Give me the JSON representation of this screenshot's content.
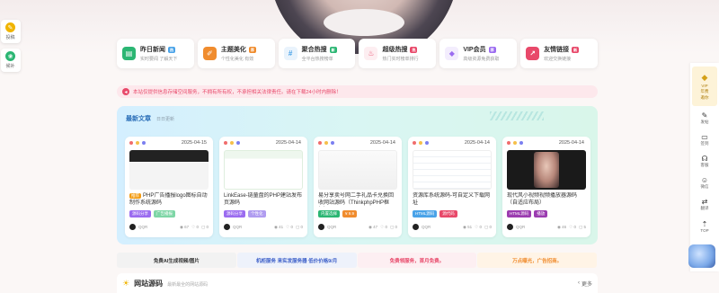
{
  "left_float": [
    {
      "icon": "lightbulb-icon",
      "label": "投稿",
      "color": "#f0b400"
    },
    {
      "icon": "leaf-icon",
      "label": "候补",
      "color": "#2bb673"
    }
  ],
  "nav": [
    {
      "title": "昨日新闻",
      "desc": "实时要闻 了解天下",
      "badge": "热",
      "icon_color": "#2bb673",
      "badge_color": "#4aa3e8",
      "icon": "news-icon"
    },
    {
      "title": "主题美化",
      "desc": "个性化美化 有效",
      "badge": "荐",
      "icon_color": "#f08c2e",
      "badge_color": "#f08c2e",
      "icon": "brush-icon"
    },
    {
      "title": "聚合热搜",
      "desc": "全平台热搜榜单",
      "badge": "新",
      "icon_color": "#4aa3e8",
      "badge_color": "#2bb673",
      "icon": "hash-icon"
    },
    {
      "title": "超级热搜",
      "desc": "热门实时榜单排行",
      "badge": "热",
      "icon_color": "#e8496a",
      "badge_color": "#e8496a",
      "icon": "fire-icon"
    },
    {
      "title": "VIP会员",
      "desc": "高级资源免费获取",
      "badge": "荐",
      "icon_color": "#9b6cf0",
      "badge_color": "#9b6cf0",
      "icon": "vip-diamond-icon"
    },
    {
      "title": "友情链接",
      "desc": "欢迎交换链接",
      "badge": "新",
      "icon_color": "#e8496a",
      "badge_color": "#e8496a",
      "icon": "link-icon"
    }
  ],
  "notice": "本站仅提供信息存储空间服务，不拥有所有权，不承担相关法律责任。请在下载24小时内删除！",
  "latest": {
    "title": "最新文章",
    "subtitle": "日日更新",
    "cards": [
      {
        "date": "2025-04-15",
        "title_tag": "推荐",
        "title": "PHP广告播报logo图标自动制作系统源码",
        "tags": [
          {
            "t": "源码分享",
            "c": "#9b6cf0"
          },
          {
            "t": "广告播报",
            "c": "#7ed6a6"
          }
        ],
        "author": "QQR",
        "views": "67",
        "likes": "0",
        "comments": "0",
        "thumb": "dark"
      },
      {
        "date": "2025-04-14",
        "title_tag": "",
        "title": "LinkEase-链童盘的PHP建站发布页源码",
        "tags": [
          {
            "t": "源码分享",
            "c": "#9b6cf0"
          },
          {
            "t": "个性化",
            "c": "#b09cf0"
          }
        ],
        "author": "QQR",
        "views": "41",
        "likes": "0",
        "comments": "0",
        "thumb": "green"
      },
      {
        "date": "2025-04-14",
        "title_tag": "",
        "title": "易分享卖号网二手礼品卡兑换回收网站源码（ThinkphpPHP框架）",
        "tags": [
          {
            "t": "内置选择",
            "c": "#2bb673"
          },
          {
            "t": "¥ 9.9",
            "c": "#f08c2e"
          }
        ],
        "author": "QQR",
        "views": "47",
        "likes": "0",
        "comments": "0",
        "thumb": "white"
      },
      {
        "date": "2025-04-14",
        "title_tag": "",
        "title": "资源库系统源码-可自定义下载网址",
        "tags": [
          {
            "t": "HTML源码",
            "c": "#4aa3e8"
          },
          {
            "t": "源代码",
            "c": "#e8496a"
          }
        ],
        "author": "QQR",
        "views": "51",
        "likes": "0",
        "comments": "0",
        "thumb": "list"
      },
      {
        "date": "2025-04-14",
        "title_tag": "",
        "title": "现代风小视频视频播放器源码（自适应布局）",
        "tags": [
          {
            "t": "HTML源码",
            "c": "#9b3cb0"
          },
          {
            "t": "播放",
            "c": "#9b3cb0"
          }
        ],
        "author": "QQR",
        "views": "46",
        "likes": "0",
        "comments": "5",
        "thumb": "photo"
      }
    ]
  },
  "buttons": [
    {
      "label": "免费AI生成视频/图片",
      "color": "#333",
      "bg": "#f2f2f2"
    },
    {
      "label": "机柜服务 来实发服务器 低价价格9/月",
      "color": "#3b5ec8",
      "bg": "#eef2fb"
    },
    {
      "label": "免费领服务，首月免费。",
      "color": "#e8496a",
      "bg": "#fdeff2"
    },
    {
      "label": "万点曝光，广告招商。",
      "color": "#f08c2e",
      "bg": "#fff4e6"
    }
  ],
  "source": {
    "title": "网站源码",
    "subtitle": "最新最全的网站源码",
    "more": "更多"
  },
  "right_bar": {
    "vip": {
      "label1": "VIP",
      "label2": "年费",
      "label3": "邀你"
    },
    "items": [
      {
        "icon": "pen-icon",
        "label": "发帖"
      },
      {
        "icon": "doc-icon",
        "label": "签到"
      },
      {
        "icon": "headset-icon",
        "label": "客服"
      },
      {
        "icon": "wechat-icon",
        "label": "微信"
      },
      {
        "icon": "translate-icon",
        "label": "翻译"
      },
      {
        "icon": "top-arrow-icon",
        "label": "TOP"
      }
    ]
  }
}
